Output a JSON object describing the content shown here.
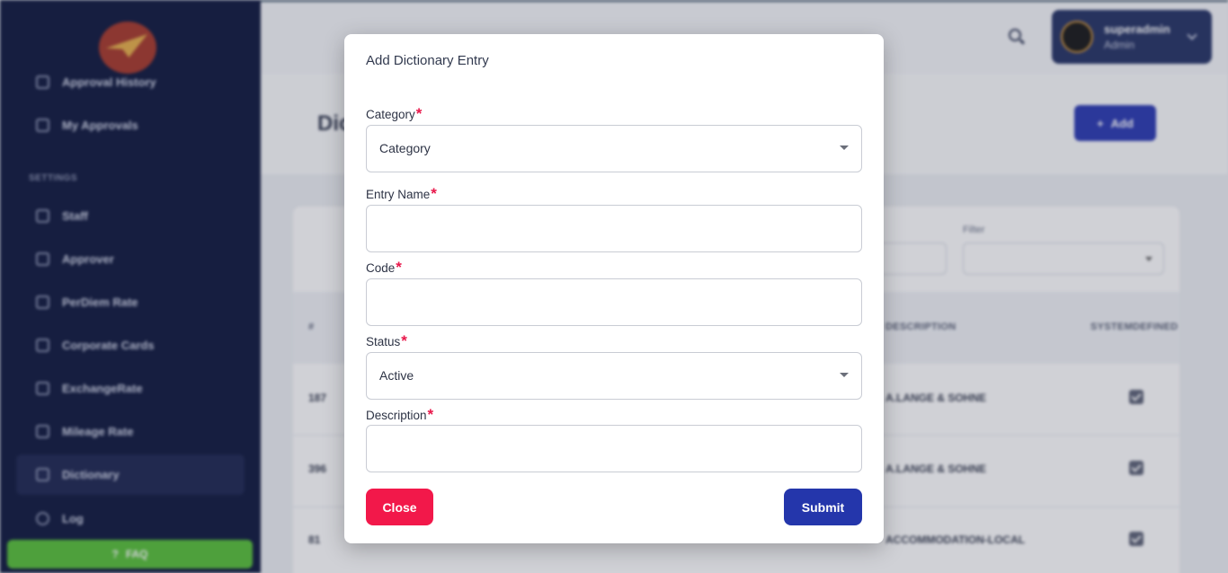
{
  "sidebar": {
    "partial_item": "Approval History",
    "items_top": [
      {
        "label": "My Approvals",
        "icon": "document-icon"
      }
    ],
    "section_label": "SETTINGS",
    "items": [
      {
        "label": "Staff",
        "icon": "users-icon"
      },
      {
        "label": "Approver",
        "icon": "user-check-icon"
      },
      {
        "label": "PerDiem Rate",
        "icon": "table-icon"
      },
      {
        "label": "Corporate Cards",
        "icon": "card-icon"
      },
      {
        "label": "ExchangeRate",
        "icon": "exchange-icon"
      },
      {
        "label": "Mileage Rate",
        "icon": "gauge-icon"
      },
      {
        "label": "Dictionary",
        "icon": "book-icon"
      },
      {
        "label": "Log",
        "icon": "clock-icon"
      }
    ],
    "faq_label": "FAQ"
  },
  "topbar": {
    "user_name": "superadmin",
    "user_role": "Admin"
  },
  "page": {
    "title_partial": "Dic",
    "add_label": "Add",
    "filter_label": "Filter"
  },
  "table": {
    "headers": [
      "#",
      "DESCRIPTION",
      "SYSTEMDEFINED"
    ],
    "rows": [
      {
        "id": "187",
        "description": "A.LANGE & SOHNE",
        "system_defined": true
      },
      {
        "id": "396",
        "description": "A.LANGE & SOHNE",
        "system_defined": true
      },
      {
        "id": "81",
        "description": "ACCOMMODATION-LOCAL",
        "system_defined": true
      }
    ]
  },
  "modal": {
    "title": "Add Dictionary Entry",
    "required_mark": "*",
    "fields": {
      "category": {
        "label": "Category",
        "value": "Category"
      },
      "entry_name": {
        "label": "Entry Name",
        "value": ""
      },
      "code": {
        "label": "Code",
        "value": ""
      },
      "status": {
        "label": "Status",
        "value": "Active"
      },
      "description": {
        "label": "Description",
        "value": ""
      }
    },
    "close_label": "Close",
    "submit_label": "Submit"
  },
  "colors": {
    "sidebar_bg": "#111a3f",
    "primary": "#2436ab",
    "danger": "#f2184a",
    "required": "#e8174a",
    "faq": "#59c13a"
  }
}
